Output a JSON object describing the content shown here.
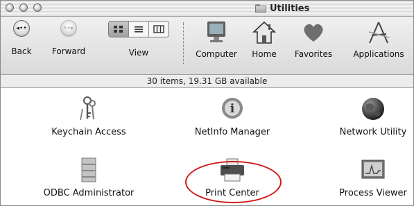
{
  "window": {
    "title": "Utilities"
  },
  "toolbar": {
    "back_label": "Back",
    "forward_label": "Forward",
    "view_label": "View",
    "computer_label": "Computer",
    "home_label": "Home",
    "favorites_label": "Favorites",
    "applications_label": "Applications"
  },
  "status": {
    "text": "30 items, 19.31 GB available"
  },
  "items": [
    {
      "label": "Keychain Access",
      "icon": "keys-icon"
    },
    {
      "label": "NetInfo Manager",
      "icon": "info-globe-icon"
    },
    {
      "label": "Network Utility",
      "icon": "globe-icon"
    },
    {
      "label": "ODBC Administrator",
      "icon": "database-icon"
    },
    {
      "label": "Print Center",
      "icon": "printer-icon"
    },
    {
      "label": "Process Viewer",
      "icon": "monitor-graph-icon"
    }
  ],
  "colors": {
    "highlight_ellipse": "#d01a1a"
  }
}
